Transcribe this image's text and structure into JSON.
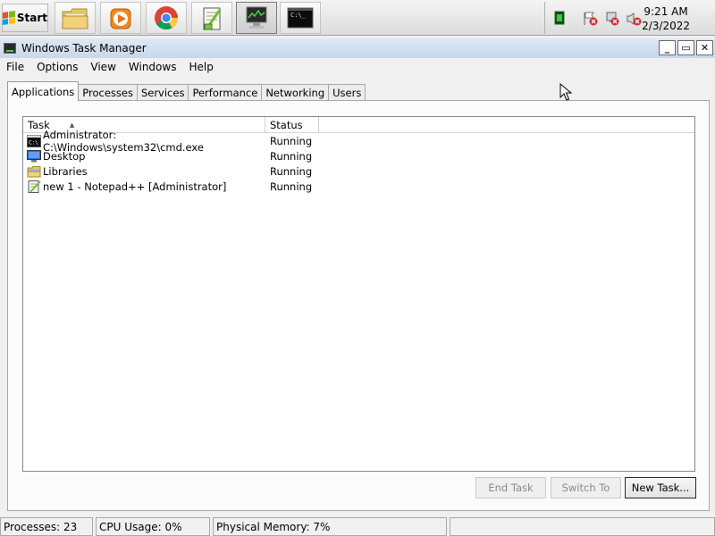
{
  "taskbar": {
    "start_label": "Start",
    "buttons": [
      {
        "name": "explorer-taskbar-button",
        "icon": "folder-icon"
      },
      {
        "name": "media-player-taskbar-button",
        "icon": "media-player-icon"
      },
      {
        "name": "chrome-taskbar-button",
        "icon": "chrome-icon"
      },
      {
        "name": "notepadpp-taskbar-button",
        "icon": "notepadpp-icon"
      },
      {
        "name": "task-manager-taskbar-button",
        "icon": "task-manager-icon",
        "active": true
      },
      {
        "name": "cmd-taskbar-button",
        "icon": "cmd-icon"
      }
    ],
    "clock": {
      "time": "9:21 AM",
      "date": "2/3/2022"
    }
  },
  "window": {
    "title": "Windows Task Manager",
    "controls": {
      "minimize": "_",
      "maximize": "▭",
      "close": "✕"
    }
  },
  "menu": [
    "File",
    "Options",
    "View",
    "Windows",
    "Help"
  ],
  "tabs": [
    {
      "label": "Applications",
      "active": true
    },
    {
      "label": "Processes"
    },
    {
      "label": "Services"
    },
    {
      "label": "Performance"
    },
    {
      "label": "Networking"
    },
    {
      "label": "Users"
    }
  ],
  "list": {
    "columns": {
      "task": "Task",
      "status": "Status"
    },
    "rows": [
      {
        "task": "Administrator: C:\\Windows\\system32\\cmd.exe",
        "status": "Running",
        "icon": "cmd-icon"
      },
      {
        "task": "Desktop",
        "status": "Running",
        "icon": "desktop-icon"
      },
      {
        "task": "Libraries",
        "status": "Running",
        "icon": "libraries-icon"
      },
      {
        "task": "new 1 - Notepad++ [Administrator]",
        "status": "Running",
        "icon": "notepadpp-icon"
      }
    ]
  },
  "buttons": {
    "end_task": "End Task",
    "switch_to": "Switch To",
    "new_task": "New Task..."
  },
  "statusbar": {
    "processes": "Processes: 23",
    "cpu": "CPU Usage: 0%",
    "memory": "Physical Memory: 7%"
  },
  "colors": {
    "accent": "#c9d7ea",
    "list_border": "#828790"
  }
}
